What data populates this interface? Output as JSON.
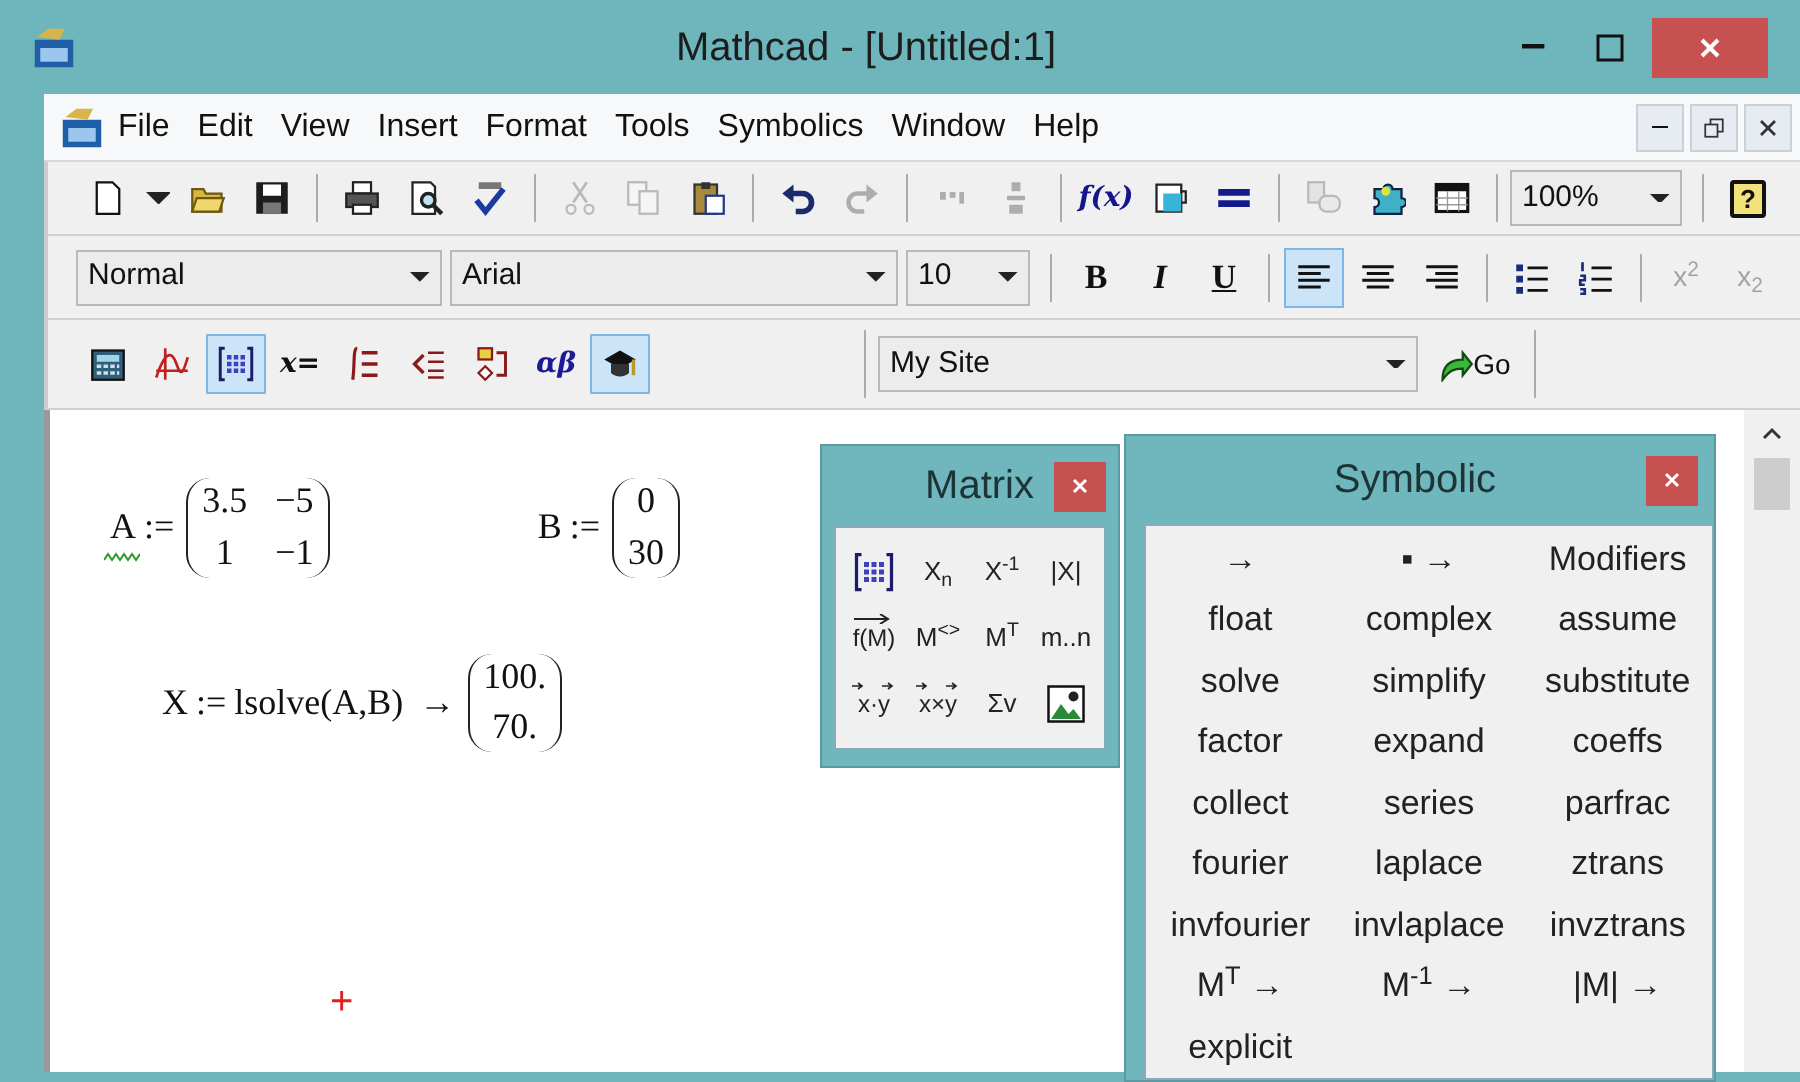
{
  "window": {
    "title": "Mathcad - [Untitled:1]"
  },
  "menu_bar": {
    "items": [
      "File",
      "Edit",
      "View",
      "Insert",
      "Format",
      "Tools",
      "Symbolics",
      "Window",
      "Help"
    ]
  },
  "standard_toolbar": {
    "buttons": [
      {
        "disabled": false
      },
      {
        "disabled": false
      },
      {
        "disabled": false
      },
      {
        "disabled": false
      },
      {
        "disabled": false
      },
      {
        "disabled": false
      },
      {
        "disabled": false
      },
      {
        "disabled": true
      },
      {
        "disabled": true
      },
      {
        "disabled": false
      },
      {
        "disabled": false
      },
      {
        "disabled": true
      },
      {
        "disabled": true
      },
      {
        "disabled": true
      },
      {
        "label": "f(x)",
        "disabled": false
      },
      {
        "disabled": false
      },
      {
        "disabled": false
      },
      {
        "disabled": true
      },
      {
        "disabled": false
      },
      {
        "disabled": false
      }
    ],
    "zoom": "100%",
    "help": "?"
  },
  "format_toolbar": {
    "style": "Normal",
    "font": "Arial",
    "size": "10",
    "text_buttons": [
      {
        "label": "B",
        "selected": false
      },
      {
        "label": "I",
        "selected": false
      },
      {
        "label": "U",
        "selected": false
      }
    ],
    "align_buttons": [
      {
        "selected": true
      },
      {
        "selected": false
      },
      {
        "selected": false
      }
    ],
    "list_buttons": [
      {
        "selected": false
      },
      {
        "selected": false
      }
    ],
    "script_buttons": [
      {
        "label": "x$^{2}$",
        "disabled": true
      },
      {
        "label": "x$_{2}$",
        "disabled": true
      }
    ]
  },
  "math_toolbar": {
    "buttons": [
      {
        "selected": false
      },
      {
        "selected": false
      },
      {
        "selected": true
      },
      {
        "label": "x=",
        "selected": false
      },
      {
        "selected": false
      },
      {
        "selected": false
      },
      {
        "selected": false
      },
      {
        "label": "αβ",
        "selected": false
      },
      {
        "selected": true
      }
    ]
  },
  "web_toolbar": {
    "address": "My Site",
    "go": "Go"
  },
  "worksheet": {
    "regions": [
      {
        "name": "A",
        "operator": ":=",
        "flagged": true,
        "matrix": [
          [
            "3.5",
            "−5"
          ],
          [
            "1",
            "−1"
          ]
        ]
      },
      {
        "name": "B",
        "operator": ":=",
        "flagged": false,
        "matrix": [
          [
            "0"
          ],
          [
            "30"
          ]
        ]
      },
      {
        "name": "X",
        "operator": ":=",
        "flagged": false,
        "expression": "lsolve(A,B)",
        "arrow": "→",
        "matrix": [
          [
            "100."
          ],
          [
            "70."
          ]
        ]
      }
    ],
    "cursor": "+"
  },
  "matrix_panel": {
    "title": "Matrix",
    "buttons": [
      {
        "kind": "icon"
      },
      {
        "kind": "text",
        "label": "X$_{n}$"
      },
      {
        "kind": "text",
        "label": "X$^{-1}$"
      },
      {
        "kind": "text",
        "label": "|X|"
      },
      {
        "kind": "vectorize",
        "label": "f(M)"
      },
      {
        "kind": "text",
        "label": "M$^{<>}$"
      },
      {
        "kind": "text",
        "label": "M$^{T}$"
      },
      {
        "kind": "text",
        "label": "m..n"
      },
      {
        "kind": "vectors",
        "label": "x·y"
      },
      {
        "kind": "vectors",
        "label": "x×y"
      },
      {
        "kind": "text",
        "label": "Σv"
      },
      {
        "kind": "icon"
      }
    ]
  },
  "symbolic_panel": {
    "title": "Symbolic",
    "keywords": [
      "→",
      "▪ →",
      "Modifiers",
      "float",
      "complex",
      "assume",
      "solve",
      "simplify",
      "substitute",
      "factor",
      "expand",
      "coeffs",
      "collect",
      "series",
      "parfrac",
      "fourier",
      "laplace",
      "ztrans",
      "invfourier",
      "invlaplace",
      "invztrans",
      "M$^{T}$ →",
      "M$^{-1}$ →",
      "|M| →",
      "explicit"
    ]
  }
}
